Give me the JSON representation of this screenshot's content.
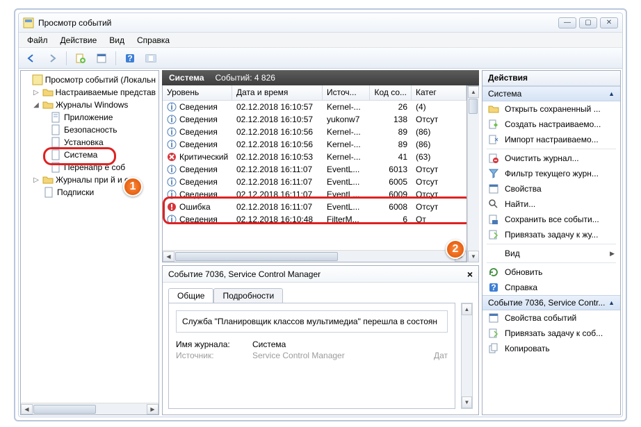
{
  "window": {
    "title": "Просмотр событий"
  },
  "menu": {
    "file": "Файл",
    "action": "Действие",
    "view": "Вид",
    "help": "Справка"
  },
  "tree": {
    "root": "Просмотр событий (Локальн",
    "custom": "Настраиваемые представ",
    "winlogs": "Журналы Windows",
    "app": "Приложение",
    "security": "Безопасность",
    "setup": "Установка",
    "system": "Система",
    "forwarded": "Перенапр                е соб",
    "appservices": "Журналы при               й и сл",
    "subscriptions": "Подписки"
  },
  "list": {
    "title": "Система",
    "count_label": "Событий: 4 826",
    "cols": {
      "level": "Уровень",
      "datetime": "Дата и время",
      "source": "Источ...",
      "code": "Код со...",
      "cat": "Катег"
    },
    "rows": [
      {
        "lvl": "info",
        "level": "Сведения",
        "dt": "02.12.2018 16:10:57",
        "src": "Kernel-...",
        "code": "26",
        "cat": "(4)"
      },
      {
        "lvl": "info",
        "level": "Сведения",
        "dt": "02.12.2018 16:10:57",
        "src": "yukonw7",
        "code": "138",
        "cat": "Отсут"
      },
      {
        "lvl": "info",
        "level": "Сведения",
        "dt": "02.12.2018 16:10:56",
        "src": "Kernel-...",
        "code": "89",
        "cat": "(86)"
      },
      {
        "lvl": "info",
        "level": "Сведения",
        "dt": "02.12.2018 16:10:56",
        "src": "Kernel-...",
        "code": "89",
        "cat": "(86)"
      },
      {
        "lvl": "crit",
        "level": "Критический",
        "dt": "02.12.2018 16:10:53",
        "src": "Kernel-...",
        "code": "41",
        "cat": "(63)"
      },
      {
        "lvl": "info",
        "level": "Сведения",
        "dt": "02.12.2018 16:11:07",
        "src": "EventL...",
        "code": "6013",
        "cat": "Отсут"
      },
      {
        "lvl": "info",
        "level": "Сведения",
        "dt": "02.12.2018 16:11:07",
        "src": "EventL...",
        "code": "6005",
        "cat": "Отсут"
      },
      {
        "lvl": "info",
        "level": "Сведения",
        "dt": "02.12.2018 16:11:07",
        "src": "EventL...",
        "code": "6009",
        "cat": "Отсут"
      },
      {
        "lvl": "err",
        "level": "Ошибка",
        "dt": "02.12.2018 16:11:07",
        "src": "EventL...",
        "code": "6008",
        "cat": "Отсут"
      },
      {
        "lvl": "info",
        "level": "Сведения",
        "dt": "02.12.2018 16:10:48",
        "src": "FilterM...",
        "code": "6",
        "cat": "От"
      }
    ]
  },
  "detail": {
    "title": "Событие 7036, Service Control Manager",
    "tab_general": "Общие",
    "tab_details": "Подробности",
    "message": "Служба \"Планировщик классов мультимедиа\" перешла в состоян",
    "log_label": "Имя журнала:",
    "log_value": "Система",
    "src_label": "Источник:",
    "src_value": "Service Control Manager",
    "date_label": "Дат"
  },
  "actions": {
    "title": "Действия",
    "sec1": "Система",
    "items1": [
      "Открыть сохраненный ...",
      "Создать настраиваемо...",
      "Импорт настраиваемо...",
      "Очистить журнал...",
      "Фильтр текущего журн...",
      "Свойства",
      "Найти...",
      "Сохранить все событи...",
      "Привязать задачу к жу...",
      "Вид",
      "Обновить",
      "Справка"
    ],
    "sec2": "Событие 7036, Service Contr...",
    "items2": [
      "Свойства событий",
      "Привязать задачу к соб...",
      "Копировать"
    ]
  },
  "badges": {
    "one": "1",
    "two": "2"
  }
}
